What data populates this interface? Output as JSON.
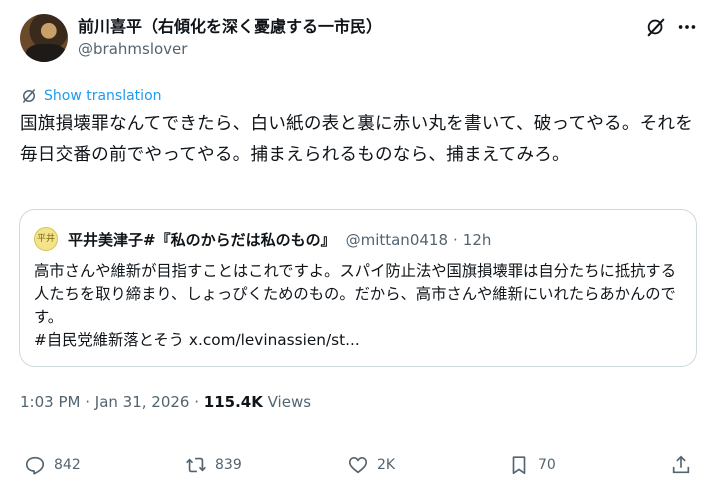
{
  "author": {
    "display_name": "前川喜平（右傾化を深く憂慮する一市民）",
    "handle": "@brahmslover"
  },
  "translate": {
    "label": "Show translation"
  },
  "tweet": {
    "text": "国旗損壊罪なんてできたら、白い紙の表と裏に赤い丸を書いて、破ってやる。それを毎日交番の前でやってやる。捕まえられるものなら、捕まえてみろ。"
  },
  "quote": {
    "avatar_text": "平井",
    "name": "平井美津子#『私のからだは私のもの』",
    "handle": "@mittan0418",
    "separator": "·",
    "time": "12h",
    "text_line1": "高市さんや維新が目指すことはこれですよ。スパイ防止法や国旗損壊罪は自分たちに抵抗する人たちを取り締まり、しょっぴくためのもの。だから、高市さんや維新にいれたらあかんのです。",
    "hashtag": "#自民党維新落とそう",
    "link": "x.com/levinassien/st..."
  },
  "meta": {
    "time": "1:03 PM",
    "dot1": " · ",
    "date": "Jan 31, 2026",
    "dot2": " · ",
    "views_count": "115.4K",
    "views_label": " Views"
  },
  "actions": {
    "replies": "842",
    "reposts": "839",
    "likes": "2K",
    "bookmarks": "70"
  },
  "colors": {
    "text": "#0f1419",
    "secondary": "#536471",
    "link": "#1d9bf0",
    "border": "#cfd9de"
  }
}
